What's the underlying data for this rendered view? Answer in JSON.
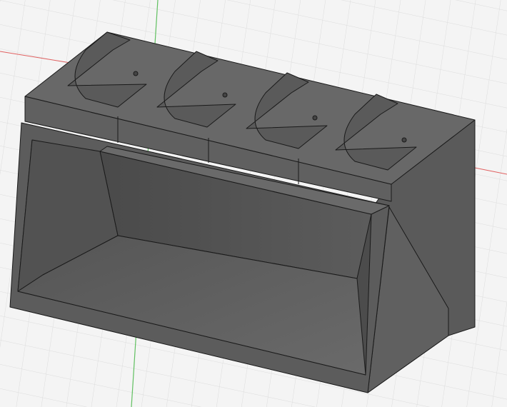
{
  "viewport": {
    "view": "3d-model-viewport",
    "model": "four-slot-organizer",
    "slot_count": 4,
    "colors": {
      "background": "#f4f4f4",
      "grid": "#dcdcdc",
      "x_axis": "#e06060",
      "y_axis": "#60c060",
      "body": "#5e5e5e",
      "top_face": "#686868",
      "side_face": "#585858",
      "inner": "#4e4e4e",
      "edge": "#1a1a1a"
    }
  }
}
